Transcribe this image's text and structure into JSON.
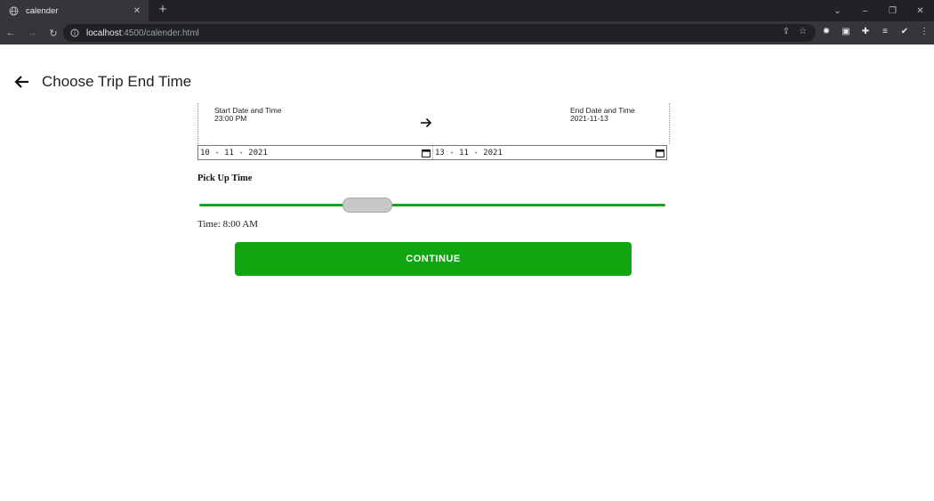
{
  "browser": {
    "tab_title": "calender",
    "tab_close": "✕",
    "new_tab": "+",
    "url_host": "localhost",
    "url_path": ":4500/calender.html",
    "window_controls": {
      "collapse": "⌄",
      "minimize": "–",
      "restore": "❐",
      "close": "✕"
    }
  },
  "header": {
    "title": "Choose Trip End Time"
  },
  "summary": {
    "start_label": "Start Date and Time",
    "start_value": "23:00 PM",
    "end_label": "End Date and Time",
    "end_value": "2021-11-13"
  },
  "dates": {
    "start": "10 - 11 - 2021",
    "end": "13 - 11 - 2021"
  },
  "pickup": {
    "label": "Pick Up Time",
    "time_text": "Time: 8:00 AM",
    "slider_fraction": 0.36
  },
  "continue_label": "CONTINUE",
  "colors": {
    "accent": "#12a512",
    "thumb": "#c8c8c8"
  }
}
